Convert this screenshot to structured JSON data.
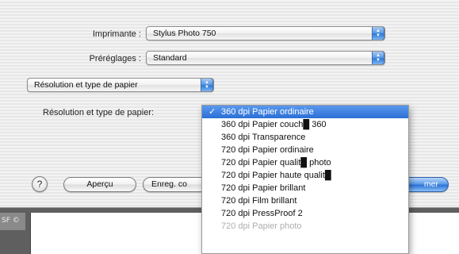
{
  "printer": {
    "label": "Imprimante :",
    "value": "Stylus Photo 750"
  },
  "presets": {
    "label": "Préréglages :",
    "value": "Standard"
  },
  "panel_popup": {
    "value": "Résolution et type de papier"
  },
  "resolution_row": {
    "label": "Résolution et type de papier:"
  },
  "menu": {
    "items": [
      {
        "label": "360 dpi Papier ordinaire",
        "selected": true,
        "check": "✓"
      },
      {
        "label": "360 dpi Papier couch█ 360",
        "selected": false
      },
      {
        "label": "360 dpi Transparence",
        "selected": false
      },
      {
        "label": "720 dpi Papier ordinaire",
        "selected": false
      },
      {
        "label": "720 dpi Papier qualit█ photo",
        "selected": false
      },
      {
        "label": "720 dpi Papier haute qualit█",
        "selected": false
      },
      {
        "label": "720 dpi Papier brillant",
        "selected": false
      },
      {
        "label": "720 dpi Film brillant",
        "selected": false
      },
      {
        "label": "720 dpi PressProof 2",
        "selected": false
      },
      {
        "label": "720 dpi Papier photo",
        "selected": false
      }
    ]
  },
  "buttons": {
    "help": "?",
    "preview": "Aperçu",
    "save_as": "Enreg. co",
    "print": "mer"
  },
  "lower_window": {
    "tab_text": "SF ©"
  }
}
